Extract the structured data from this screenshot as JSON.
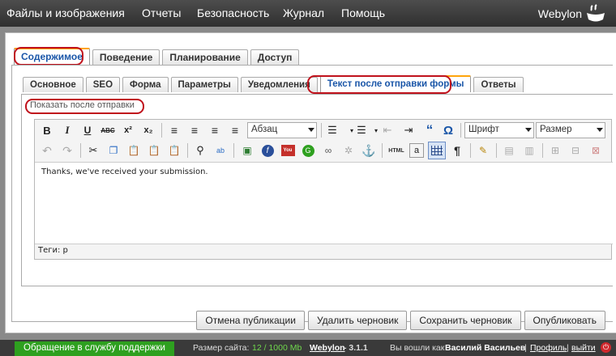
{
  "topbar": {
    "menu": [
      "Файлы и изображения",
      "Отчеты",
      "Безопасность",
      "Журнал",
      "Помощь"
    ],
    "brand": "Webylon"
  },
  "main_tabs": [
    {
      "label": "Содержимое",
      "active": true
    },
    {
      "label": "Поведение",
      "active": false
    },
    {
      "label": "Планирование",
      "active": false
    },
    {
      "label": "Доступ",
      "active": false
    }
  ],
  "sub_tabs": [
    {
      "label": "Основное",
      "active": false
    },
    {
      "label": "SEO",
      "active": false
    },
    {
      "label": "Форма",
      "active": false
    },
    {
      "label": "Параметры",
      "active": false
    },
    {
      "label": "Уведомления",
      "active": false
    },
    {
      "label": "Текст после отправки формы",
      "active": true
    },
    {
      "label": "Ответы",
      "active": false
    }
  ],
  "field_label": "Показать после отправки",
  "toolbar": {
    "format_select": "Абзац",
    "font_select": "Шрифт",
    "size_select": "Размер",
    "html_label": "HTML"
  },
  "editor": {
    "content": "Thanks, we've received your submission.",
    "path": "Теги: p"
  },
  "buttons": {
    "unpublish": "Отмена публикации",
    "delete_draft": "Удалить черновик",
    "save_draft": "Сохранить черновик",
    "publish": "Опубликовать"
  },
  "footer": {
    "support": "Обращение в службу поддержки",
    "site_size_label": "Размер сайта:",
    "site_size_value": "12 / 1000 Mb",
    "brand_link": "Webylon",
    "version": "-  3.1.1",
    "logged_in_prefix": "Вы вошли как",
    "user_name": "Василий Васильев",
    "profile_link": "Профиль",
    "logout_link": "выйти",
    "separator": "|"
  }
}
